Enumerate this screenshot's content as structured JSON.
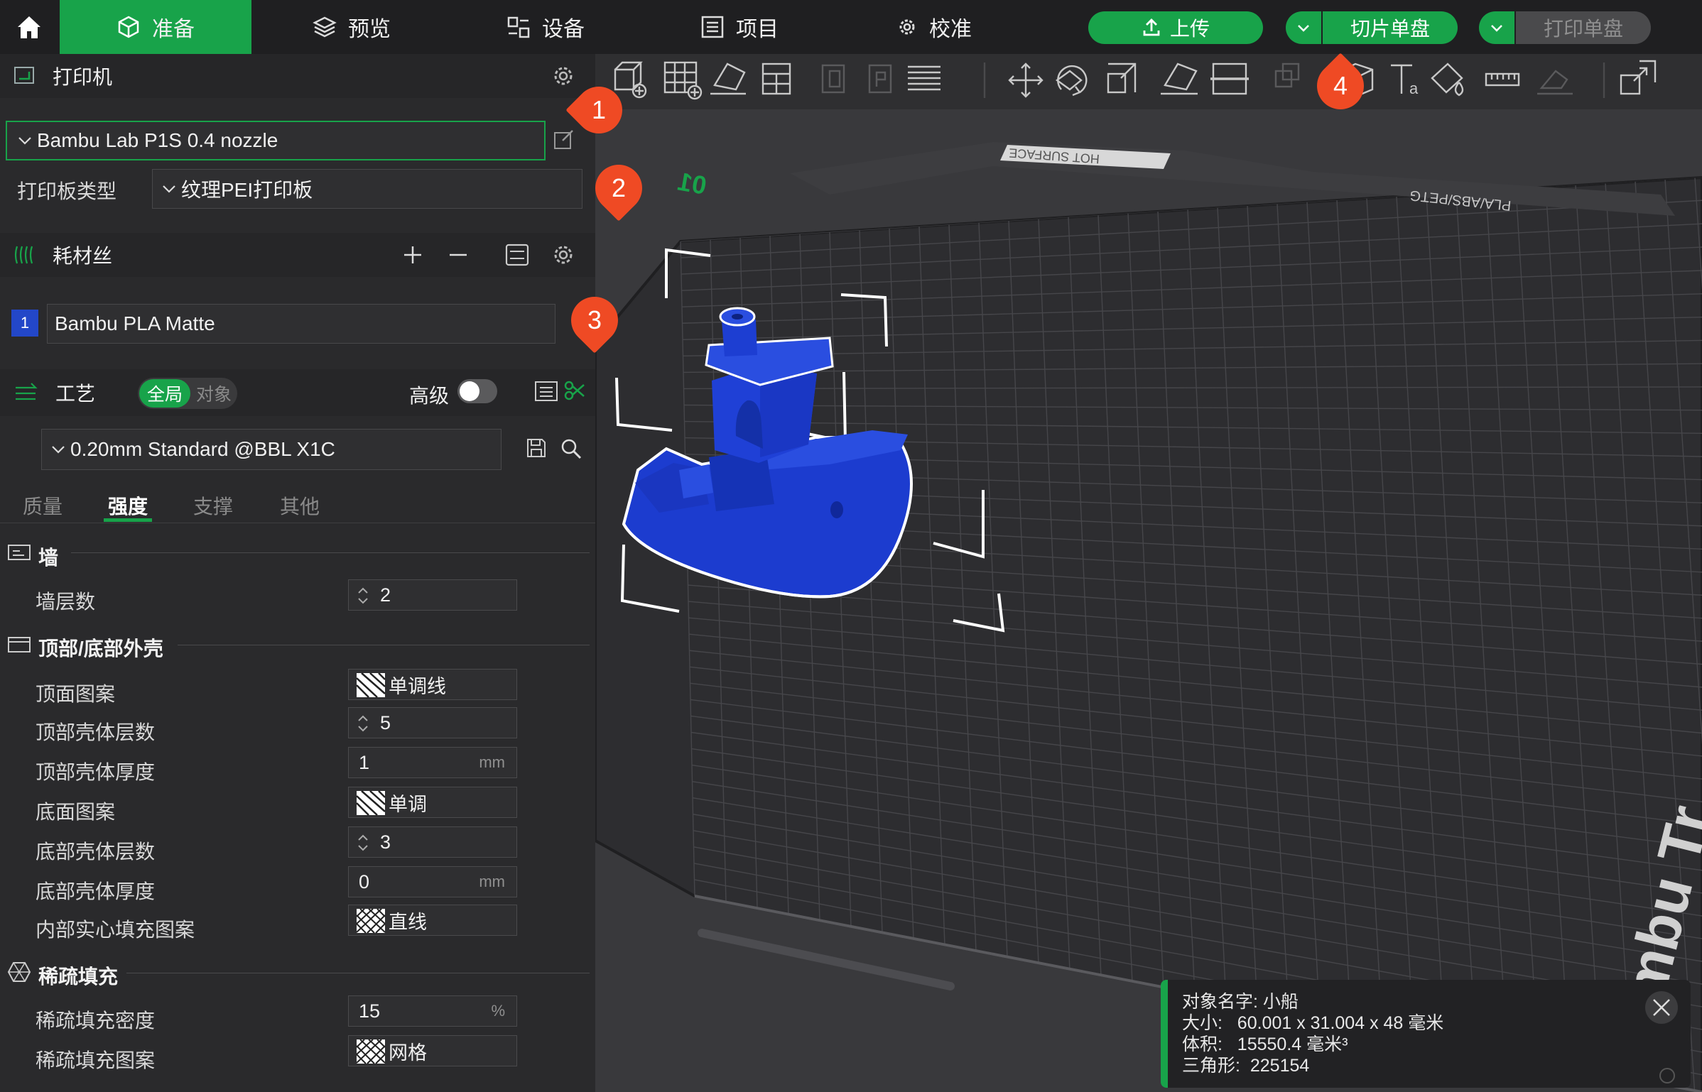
{
  "topbar": {
    "tabs": [
      {
        "label": "准备",
        "icon": "cube-icon",
        "active": true
      },
      {
        "label": "预览",
        "icon": "layers-icon"
      },
      {
        "label": "设备",
        "icon": "device-icon"
      },
      {
        "label": "项目",
        "icon": "list-icon"
      },
      {
        "label": "校准",
        "icon": "gear-icon"
      }
    ],
    "upload_label": "上传",
    "slice_label": "切片单盘",
    "print_label": "打印单盘"
  },
  "printer": {
    "title": "打印机",
    "selected": "Bambu Lab P1S 0.4 nozzle",
    "plate_type_label": "打印板类型",
    "plate_type_value": "纹理PEI打印板"
  },
  "filament": {
    "title": "耗材丝",
    "slot_number": "1",
    "slot_color": "#2347c8",
    "name": "Bambu PLA Matte"
  },
  "process": {
    "title": "工艺",
    "mode_global": "全局",
    "mode_object": "对象",
    "advanced_label": "高级",
    "preset": "0.20mm Standard @BBL X1C",
    "tabs": [
      "质量",
      "强度",
      "支撑",
      "其他"
    ],
    "active_tab": "强度"
  },
  "settings": {
    "wall": {
      "title": "墙",
      "wall_loops": {
        "label": "墙层数",
        "value": "2"
      }
    },
    "shell": {
      "title": "顶部/底部外壳",
      "top_pattern": {
        "label": "顶面图案",
        "value": "单调线"
      },
      "top_layers": {
        "label": "顶部壳体层数",
        "value": "5"
      },
      "top_thickness": {
        "label": "顶部壳体厚度",
        "value": "1",
        "unit": "mm"
      },
      "bottom_pattern": {
        "label": "底面图案",
        "value": "单调"
      },
      "bottom_layers": {
        "label": "底部壳体层数",
        "value": "3"
      },
      "bottom_thickness": {
        "label": "底部壳体厚度",
        "value": "0",
        "unit": "mm"
      },
      "internal_pattern": {
        "label": "内部实心填充图案",
        "value": "直线"
      }
    },
    "infill": {
      "title": "稀疏填充",
      "density": {
        "label": "稀疏填充密度",
        "value": "15",
        "unit": "%"
      },
      "pattern": {
        "label": "稀疏填充图案",
        "value": "网格"
      }
    }
  },
  "annotations": [
    "1",
    "2",
    "3",
    "4"
  ],
  "plate": {
    "plate_number": "01",
    "edge_text": "HOT SURFACE",
    "material_text": "PLA/ABS/PETG",
    "brand_text": "mbu Tr"
  },
  "model_info": {
    "name_label": "对象名字:",
    "name_value": "小船",
    "size_label": "大小:",
    "size_value": "60.001 x 31.004 x 48 毫米",
    "volume_label": "体积:",
    "volume_value": "15550.4 毫米³",
    "triangles_label": "三角形:",
    "triangles_value": "225154"
  },
  "colors": {
    "accent": "#18a34a",
    "badge": "#ef4a24",
    "model": "#1f3fd6"
  }
}
